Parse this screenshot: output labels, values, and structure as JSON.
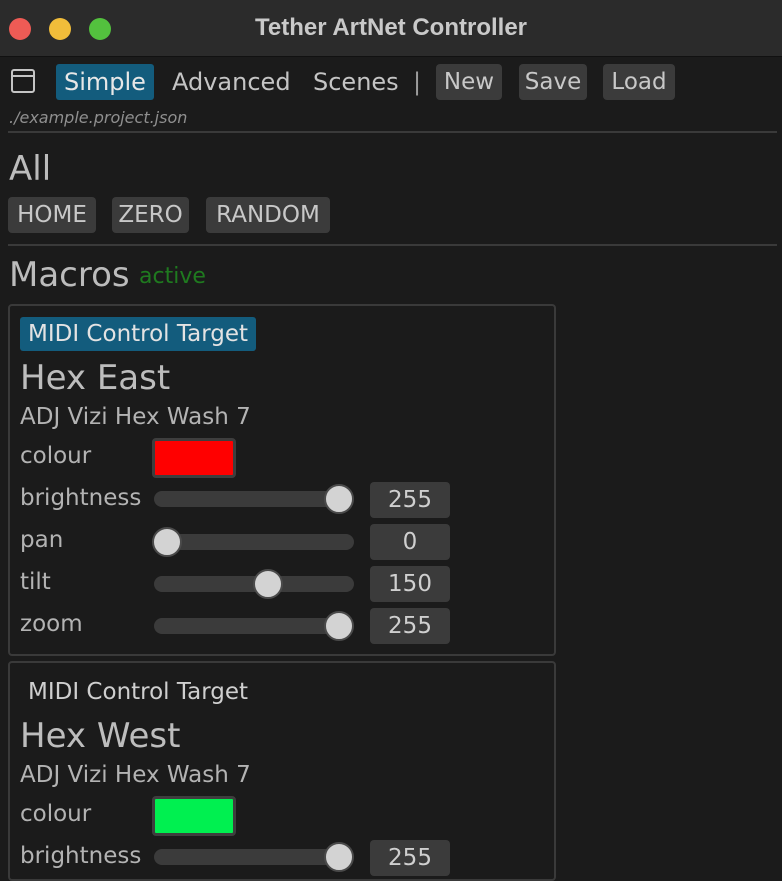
{
  "window": {
    "title": "Tether ArtNet Controller"
  },
  "nav": {
    "simple": "Simple",
    "advanced": "Advanced",
    "scenes": "Scenes",
    "separator": "|",
    "new": "New",
    "save": "Save",
    "load": "Load"
  },
  "project_path": "./example.project.json",
  "all_section": {
    "heading": "All",
    "buttons": [
      "HOME",
      "ZERO",
      "RANDOM"
    ]
  },
  "macros_section": {
    "heading": "Macros",
    "status": "active",
    "status_color": "#1f7a1f"
  },
  "devices": [
    {
      "midi_label": "MIDI Control Target",
      "midi_active": true,
      "name": "Hex East",
      "model": "ADJ Vizi Hex Wash 7",
      "colour_label": "colour",
      "colour": "#ff0000",
      "params": [
        {
          "label": "brightness",
          "value": "255"
        },
        {
          "label": "pan",
          "value": "0"
        },
        {
          "label": "tilt",
          "value": "150"
        },
        {
          "label": "zoom",
          "value": "255"
        }
      ]
    },
    {
      "midi_label": "MIDI Control Target",
      "midi_active": false,
      "name": "Hex West",
      "model": "ADJ Vizi Hex Wash 7",
      "colour_label": "colour",
      "colour": "#00f050",
      "params": [
        {
          "label": "brightness",
          "value": "255"
        }
      ]
    }
  ]
}
